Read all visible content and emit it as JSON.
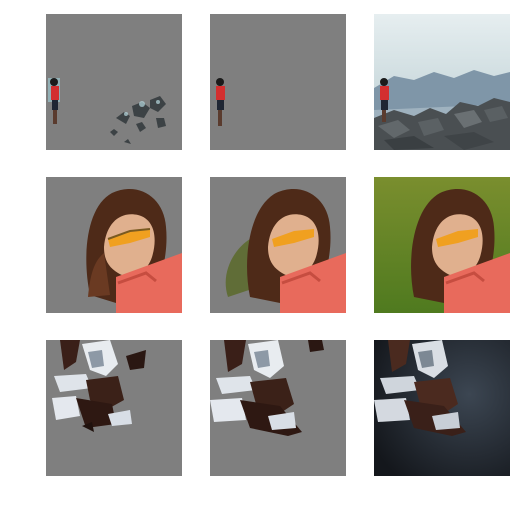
{
  "figure": {
    "rows": [
      "person-on-rocks",
      "woman-with-sunglasses",
      "crouching-dancer"
    ],
    "columns": [
      "predicted-mask-cutout",
      "ground-truth-cutout",
      "original-image"
    ],
    "colors": {
      "mask_background": "#7f7f7f",
      "page_background": "#ffffff"
    }
  }
}
